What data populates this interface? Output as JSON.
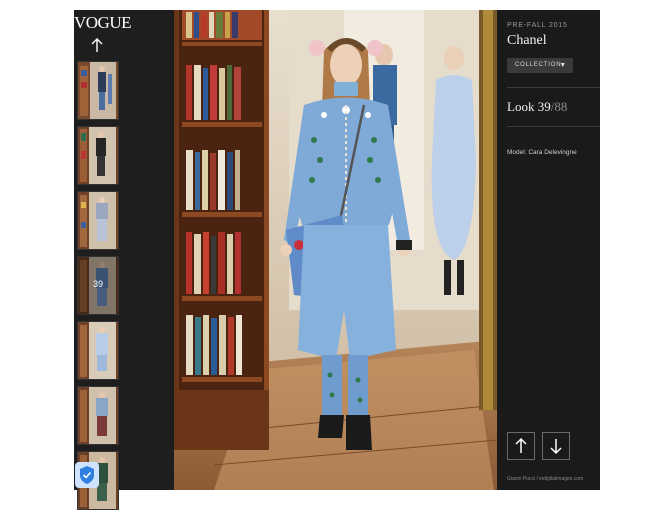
{
  "rail": {
    "logo": "VOGUE",
    "thumbnails": [
      {
        "label": ""
      },
      {
        "label": ""
      },
      {
        "label": ""
      },
      {
        "label": "39"
      },
      {
        "label": ""
      },
      {
        "label": ""
      },
      {
        "label": ""
      }
    ]
  },
  "panel": {
    "season": "PRE-FALL 2015",
    "brand": "Chanel",
    "collection_label": "COLLECTION",
    "look_prefix": "Look ",
    "look_current": "39",
    "look_total": "/88",
    "model": "Model: Cara Delevingne",
    "credit": "Gianni Pucci / indigitalimages.com"
  },
  "icons": {
    "rail_up": "arrow-up-icon",
    "prev": "arrow-up-icon",
    "next": "arrow-down-icon",
    "dropdown": "caret-down-icon",
    "shield": "shield-icon"
  },
  "colors": {
    "background": "#1b1b1b",
    "panel": "#1a1a1a",
    "button": "#3a3a3a",
    "text": "#ffffff",
    "muted": "#8c8c8c"
  }
}
